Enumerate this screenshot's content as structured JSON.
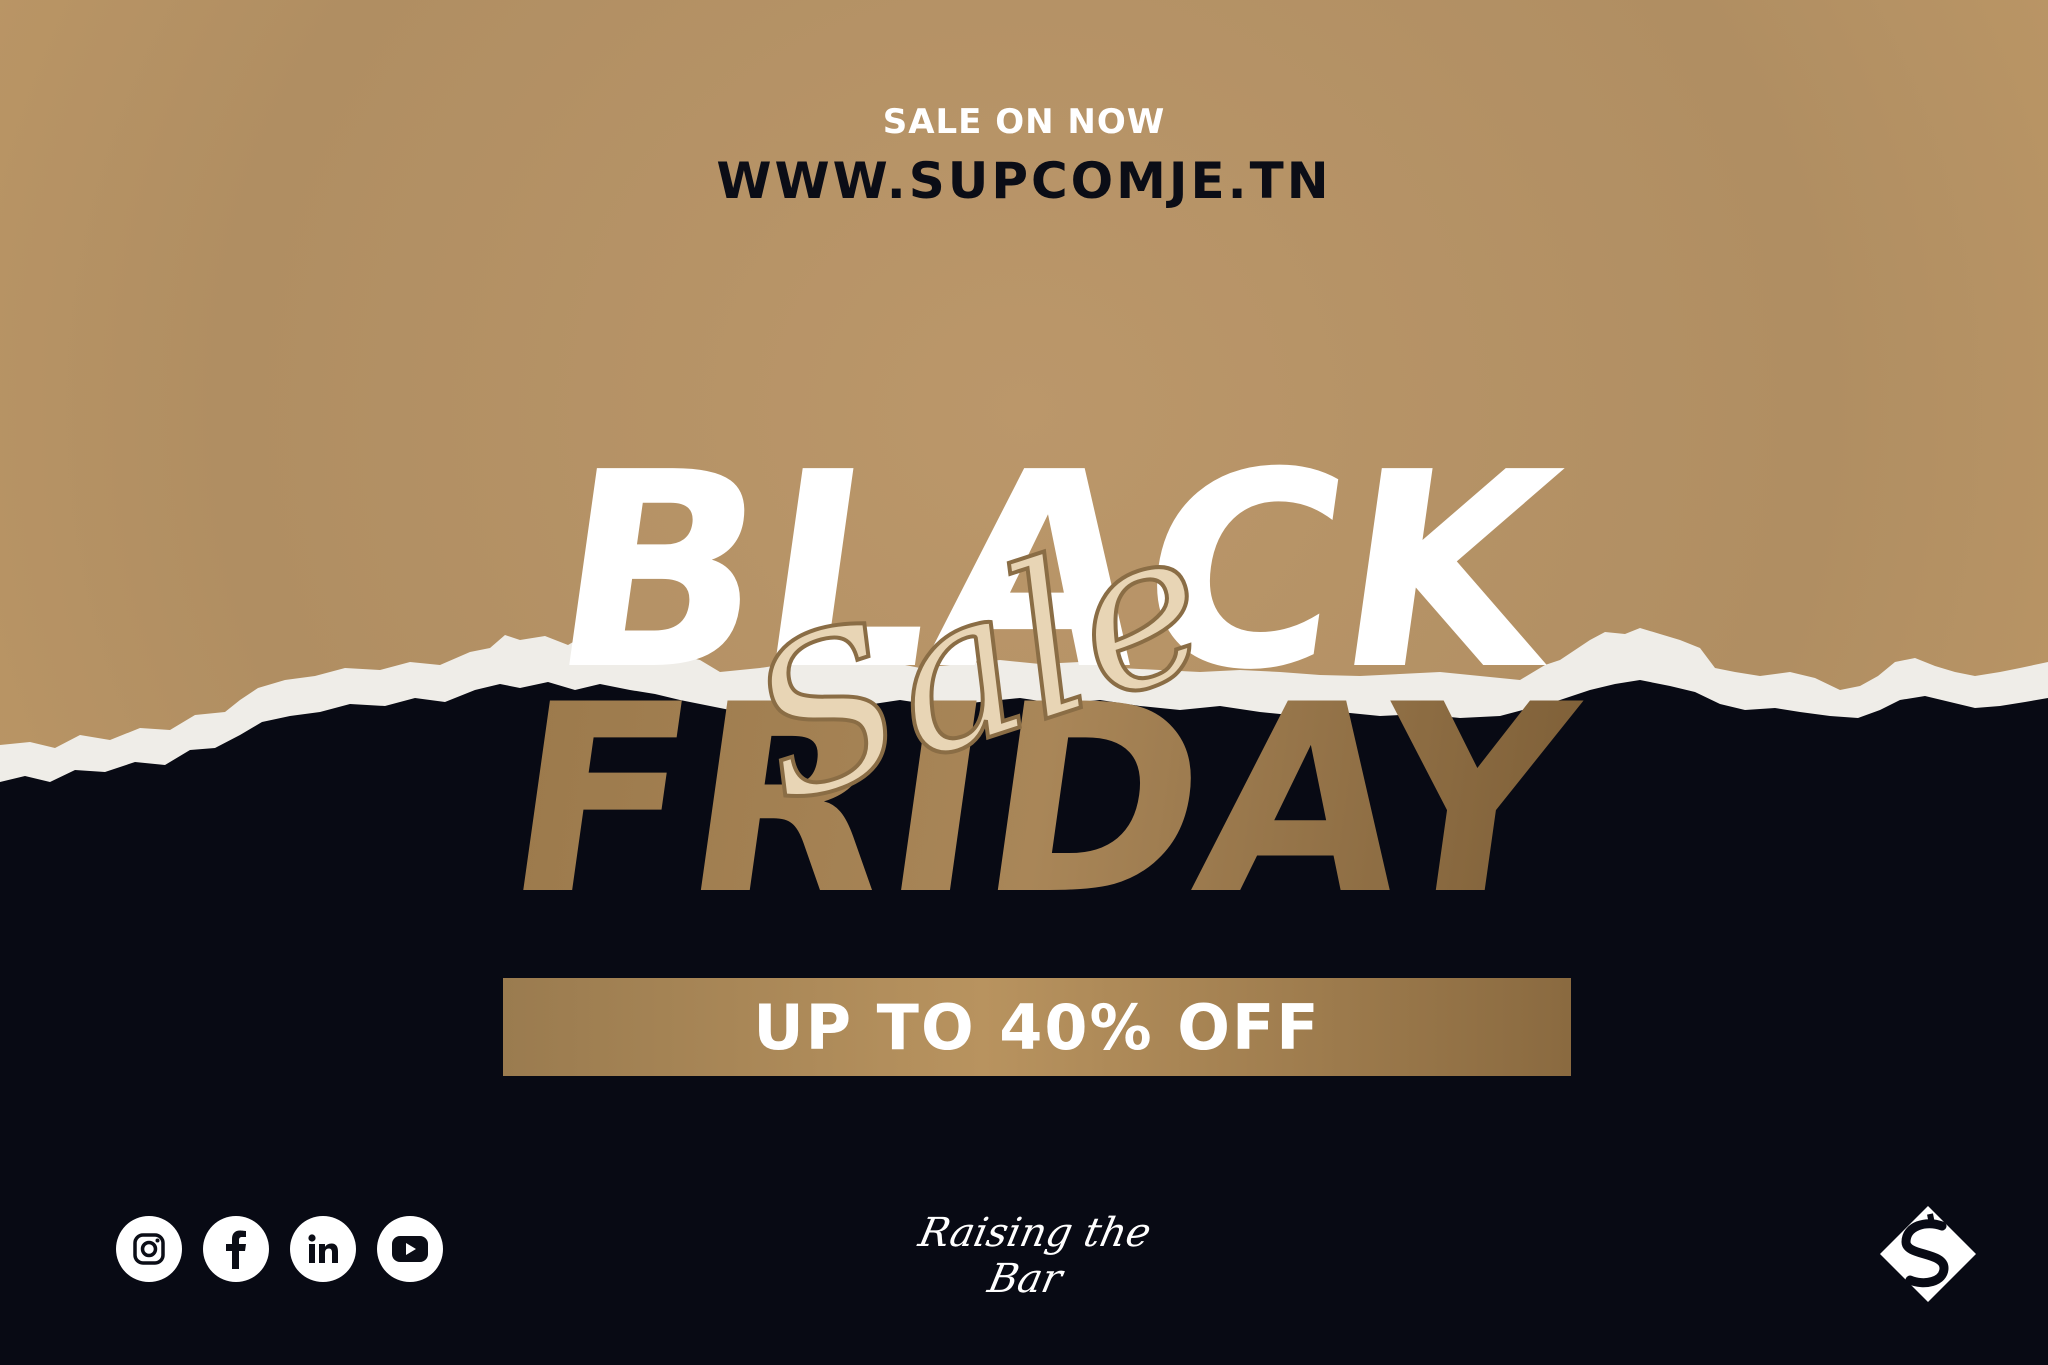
{
  "header": {
    "sale_on": "SALE ON NOW",
    "website": "WWW.SUPCOMJE.TN"
  },
  "headline": {
    "line1": "BLACK",
    "line2": "FRIDAY",
    "script": "Sale"
  },
  "discount": {
    "text": "UP TO 40% OFF"
  },
  "footer": {
    "social_icons": [
      "instagram-icon",
      "facebook-icon",
      "linkedin-icon",
      "youtube-icon"
    ],
    "tagline": "Raising the Bar",
    "logo": "supcom-logo"
  },
  "colors": {
    "tan_background": "#b8956a",
    "dark_background": "#080a14",
    "gold_text": "#9c7a4c",
    "white": "#ffffff"
  }
}
